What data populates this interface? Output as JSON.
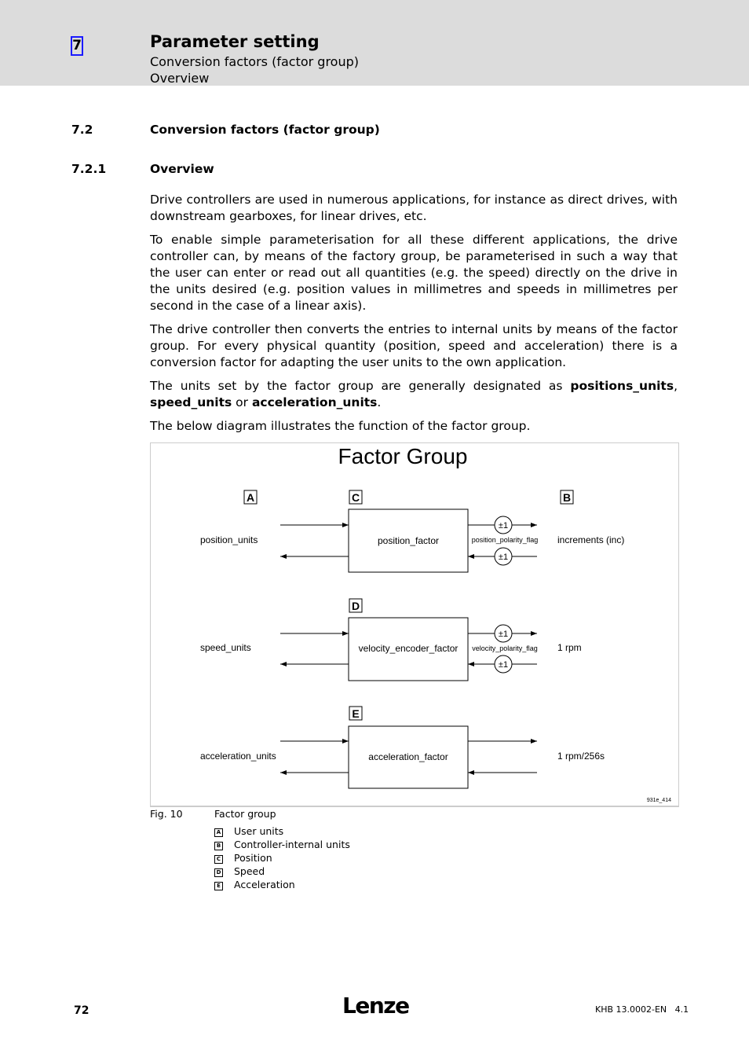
{
  "header": {
    "chapter": "7",
    "title": "Parameter setting",
    "sub1": "Conversion factors (factor group)",
    "sub2": "Overview"
  },
  "sections": [
    {
      "num": "7.2",
      "title": "Conversion factors (factor group)"
    },
    {
      "num": "7.2.1",
      "title": "Overview"
    }
  ],
  "paragraphs": {
    "p1": "Drive controllers are used in numerous applications, for instance as direct drives, with downstream gearboxes, for linear drives, etc.",
    "p2": "To enable simple parameterisation for all these different applications, the drive controller can, by means of the factory group, be parameterised in such a way that the user can enter or read out all quantities (e.g. the speed) directly on the drive in the units desired (e.g. position values in millimetres and speeds in millimetres per second in the case of a linear axis).",
    "p3": "The drive controller then converts the entries to internal units by means of the factor group. For every physical quantity (position, speed and acceleration) there is a conversion factor for adapting the user units to the own application.",
    "p4a": "The units set by the factor group are generally designated as ",
    "p4b": "positions_units",
    "p4c": ", ",
    "p4d": "speed_units",
    "p4e": " or ",
    "p4f": "acceleration_units",
    "p4g": ".",
    "p5": "The below diagram illustrates the function of the factor group."
  },
  "diagram": {
    "title": "Factor Group",
    "labels": {
      "A": "A",
      "B": "B",
      "C": "C",
      "D": "D",
      "E": "E"
    },
    "rows": [
      {
        "user": "position_units",
        "factor": "position_factor",
        "flag": "position_polarity_flag",
        "internal": "increments (inc)",
        "sign": "±1"
      },
      {
        "user": "speed_units",
        "factor": "velocity_encoder_factor",
        "flag": "velocity_polarity_flag",
        "internal": "1 rpm",
        "sign": "±1"
      },
      {
        "user": "acceleration_units",
        "factor": "acceleration_factor",
        "internal": "1 rpm/256s"
      }
    ],
    "code": "931e_414"
  },
  "caption": {
    "num": "Fig. 10",
    "title": "Factor group",
    "legend": [
      {
        "k": "A",
        "v": "User units"
      },
      {
        "k": "B",
        "v": "Controller-internal units"
      },
      {
        "k": "C",
        "v": "Position"
      },
      {
        "k": "D",
        "v": "Speed"
      },
      {
        "k": "E",
        "v": "Acceleration"
      }
    ]
  },
  "footer": {
    "page": "72",
    "logo": "Lenze",
    "doc": "KHB 13.0002-EN   4.1"
  }
}
